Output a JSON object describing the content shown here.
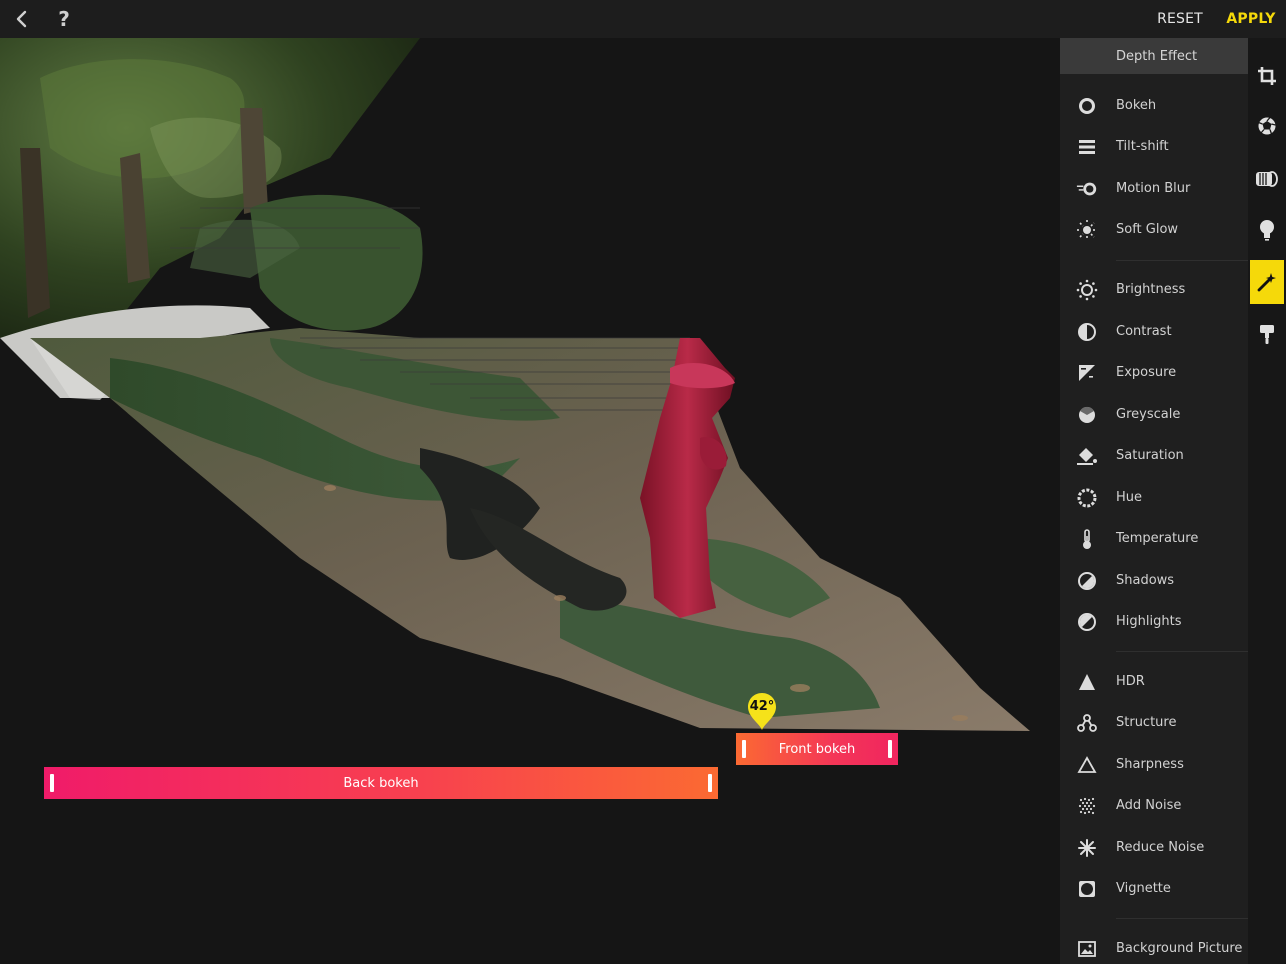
{
  "topbar": {
    "back_icon": "chevron-left-icon",
    "help_label": "?",
    "reset_label": "RESET",
    "apply_label": "APPLY",
    "accent_color": "#f5d90a"
  },
  "canvas": {
    "back_bokeh_label": "Back bokeh",
    "front_bokeh_label": "Front bokeh",
    "angle_label": "42°"
  },
  "panel": {
    "header": "Depth Effect",
    "groups": [
      [
        {
          "label": "Bokeh",
          "icon": "aperture-ring-icon"
        },
        {
          "label": "Tilt-shift",
          "icon": "tilt-shift-icon"
        },
        {
          "label": "Motion Blur",
          "icon": "motion-blur-icon"
        },
        {
          "label": "Soft Glow",
          "icon": "soft-glow-icon"
        }
      ],
      [
        {
          "label": "Brightness",
          "icon": "sun-icon"
        },
        {
          "label": "Contrast",
          "icon": "contrast-icon"
        },
        {
          "label": "Exposure",
          "icon": "exposure-icon"
        },
        {
          "label": "Greyscale",
          "icon": "greyscale-icon"
        },
        {
          "label": "Saturation",
          "icon": "paint-bucket-icon"
        },
        {
          "label": "Hue",
          "icon": "hue-icon"
        },
        {
          "label": "Temperature",
          "icon": "thermometer-icon"
        },
        {
          "label": "Shadows",
          "icon": "shadows-icon"
        },
        {
          "label": "Highlights",
          "icon": "highlights-icon"
        }
      ],
      [
        {
          "label": "HDR",
          "icon": "hdr-triangle-icon"
        },
        {
          "label": "Structure",
          "icon": "structure-icon"
        },
        {
          "label": "Sharpness",
          "icon": "sharpness-icon"
        },
        {
          "label": "Add Noise",
          "icon": "add-noise-icon"
        },
        {
          "label": "Reduce Noise",
          "icon": "reduce-noise-icon"
        },
        {
          "label": "Vignette",
          "icon": "vignette-icon"
        }
      ],
      [
        {
          "label": "Background Picture",
          "icon": "picture-icon"
        }
      ]
    ]
  },
  "rail": {
    "tools": [
      {
        "icon": "crop-icon"
      },
      {
        "icon": "aperture-icon"
      },
      {
        "icon": "lens-icon"
      },
      {
        "icon": "lightbulb-icon"
      },
      {
        "icon": "magic-wand-icon",
        "active": true
      },
      {
        "icon": "paint-roller-icon"
      }
    ]
  }
}
